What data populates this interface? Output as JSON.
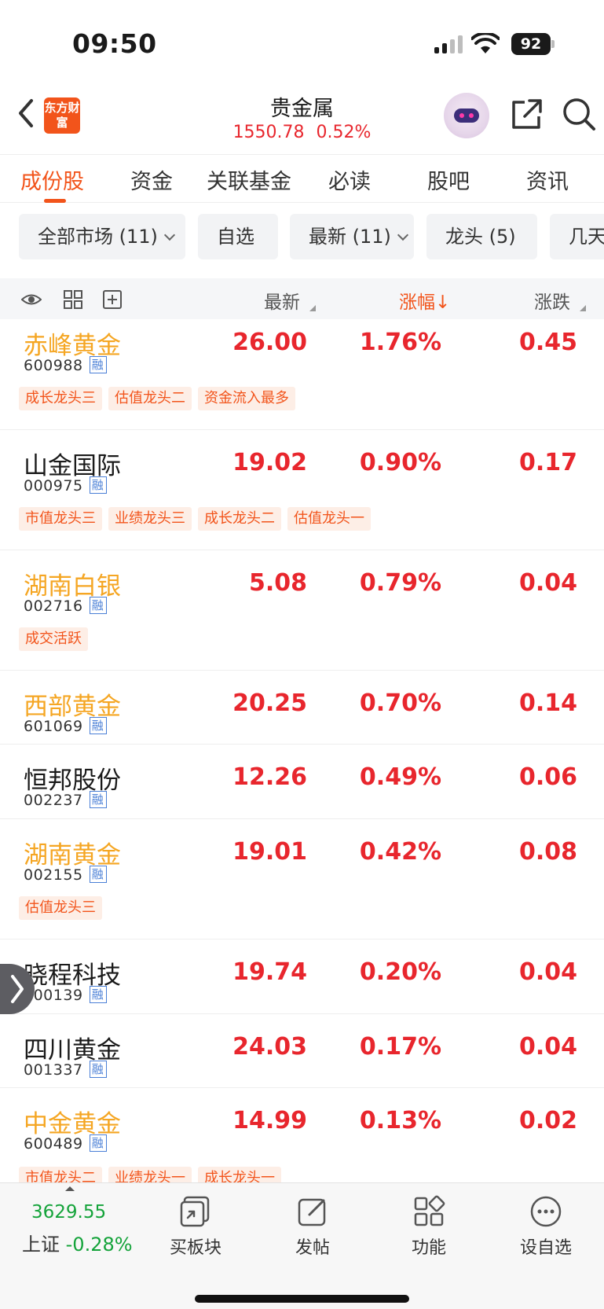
{
  "status_bar": {
    "time": "09:50",
    "battery": "92"
  },
  "header": {
    "logo_text": "东方财富",
    "title": "贵金属",
    "index_value": "1550.78",
    "index_change": "0.52%"
  },
  "tabs": [
    {
      "label": "成份股",
      "active": true
    },
    {
      "label": "资金"
    },
    {
      "label": "关联基金"
    },
    {
      "label": "必读"
    },
    {
      "label": "股吧"
    },
    {
      "label": "资讯"
    }
  ],
  "filters": [
    {
      "label": "全部市场 (11)"
    },
    {
      "label": "自选"
    },
    {
      "label": "最新 (11)"
    },
    {
      "label": "龙头 (5)"
    },
    {
      "label": "几天"
    }
  ],
  "columns": {
    "latest": "最新",
    "change_pct": "涨幅",
    "sort_arrow": "↓",
    "change": "涨跌"
  },
  "rong_label": "融",
  "stocks": [
    {
      "name": "赤峰黄金",
      "code": "600988",
      "highlight": true,
      "price": "26.00",
      "pct": "1.76%",
      "chg": "0.45",
      "tags": [
        "成长龙头三",
        "估值龙头二",
        "资金流入最多"
      ]
    },
    {
      "name": "山金国际",
      "code": "000975",
      "highlight": false,
      "price": "19.02",
      "pct": "0.90%",
      "chg": "0.17",
      "tags": [
        "市值龙头三",
        "业绩龙头三",
        "成长龙头二",
        "估值龙头一"
      ]
    },
    {
      "name": "湖南白银",
      "code": "002716",
      "highlight": true,
      "price": "5.08",
      "pct": "0.79%",
      "chg": "0.04",
      "tags": [
        "成交活跃"
      ]
    },
    {
      "name": "西部黄金",
      "code": "601069",
      "highlight": true,
      "price": "20.25",
      "pct": "0.70%",
      "chg": "0.14",
      "tags": []
    },
    {
      "name": "恒邦股份",
      "code": "002237",
      "highlight": false,
      "price": "12.26",
      "pct": "0.49%",
      "chg": "0.06",
      "tags": []
    },
    {
      "name": "湖南黄金",
      "code": "002155",
      "highlight": true,
      "price": "19.01",
      "pct": "0.42%",
      "chg": "0.08",
      "tags": [
        "估值龙头三"
      ]
    },
    {
      "name": "晓程科技",
      "code": "300139",
      "highlight": false,
      "price": "19.74",
      "pct": "0.20%",
      "chg": "0.04",
      "tags": []
    },
    {
      "name": "四川黄金",
      "code": "001337",
      "highlight": false,
      "price": "24.03",
      "pct": "0.17%",
      "chg": "0.04",
      "tags": []
    },
    {
      "name": "中金黄金",
      "code": "600489",
      "highlight": true,
      "price": "14.99",
      "pct": "0.13%",
      "chg": "0.02",
      "tags": [
        "市值龙头二",
        "业绩龙头一",
        "成长龙头一"
      ]
    }
  ],
  "bottom_bar": {
    "index_value": "3629.55",
    "index_name": "上证",
    "index_pct": "-0.28%",
    "items": [
      {
        "label": "买板块",
        "icon": "buy-sector-icon"
      },
      {
        "label": "发帖",
        "icon": "compose-icon"
      },
      {
        "label": "功能",
        "icon": "grid-icon"
      },
      {
        "label": "设自选",
        "icon": "more-dots-icon"
      }
    ]
  },
  "colors": {
    "accent": "#f2541b",
    "up": "#e8262d",
    "down": "#14a33a",
    "highlight_name": "#f5a623"
  }
}
